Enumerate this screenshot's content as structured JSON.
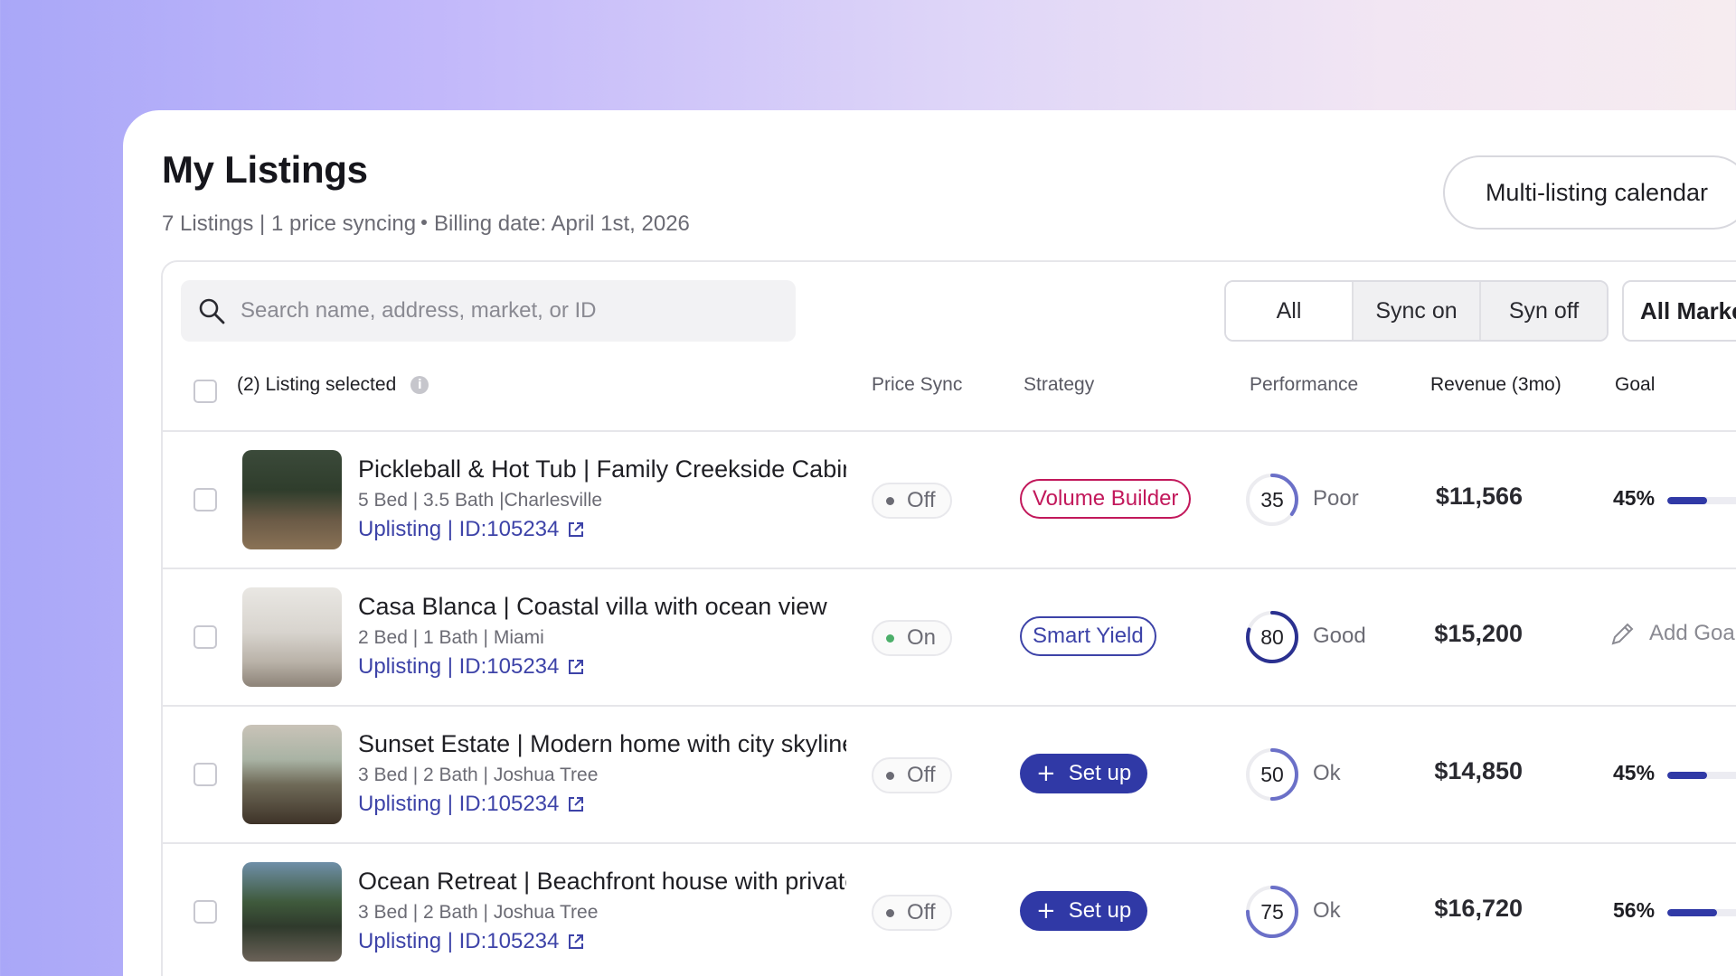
{
  "header": {
    "title": "My Listings",
    "summary": "7 Listings | 1 price syncing",
    "billing": "Billing date: April 1st, 2026",
    "calendar_button": "Multi-listing calendar"
  },
  "toolbar": {
    "search_placeholder": "Search name, address, market, or ID",
    "filters": [
      "All",
      "Sync on",
      "Syn off"
    ],
    "market_filter": "All Markets"
  },
  "table": {
    "selection_label": "(2) Listing selected",
    "columns": {
      "price_sync": "Price Sync",
      "strategy": "Strategy",
      "performance": "Performance",
      "revenue": "Revenue (3mo)",
      "goal": "Goal"
    },
    "rows": [
      {
        "name": "Pickleball & Hot Tub | Family Creekside Cabin",
        "meta": "5 Bed | 3.5 Bath |Charlesville",
        "link": "Uplisting | ID:105234",
        "sync": "Off",
        "strategy": "Volume Builder",
        "strategy_type": "outline",
        "strategy_color": "#c2185b",
        "score": "35",
        "score_value": 35,
        "rating": "Poor",
        "revenue": "$11,566",
        "goal": "45%",
        "goal_value": 0.45
      },
      {
        "name": "Casa Blanca | Coastal villa with ocean view",
        "meta": "2 Bed | 1 Bath | Miami",
        "link": "Uplisting | ID:105234",
        "sync": "On",
        "strategy": "Smart Yield",
        "strategy_type": "outline",
        "strategy_color": "#3d43a8",
        "score": "80",
        "score_value": 80,
        "rating": "Good",
        "revenue": "$15,200",
        "goal": "Add Goal",
        "goal_value": null
      },
      {
        "name": "Sunset Estate | Modern home with city skyline",
        "meta": "3 Bed | 2 Bath | Joshua Tree",
        "link": "Uplisting | ID:105234",
        "sync": "Off",
        "strategy": "Set up",
        "strategy_type": "button",
        "strategy_color": "#3039a6",
        "score": "50",
        "score_value": 50,
        "rating": "Ok",
        "revenue": "$14,850",
        "goal": "45%",
        "goal_value": 0.45
      },
      {
        "name": "Ocean Retreat | Beachfront house with private pool",
        "meta": "3 Bed | 2 Bath | Joshua Tree",
        "link": "Uplisting | ID:105234",
        "sync": "Off",
        "strategy": "Set up",
        "strategy_type": "button",
        "strategy_color": "#3039a6",
        "score": "75",
        "score_value": 75,
        "rating": "Ok",
        "revenue": "$16,720",
        "goal": "56%",
        "goal_value": 0.56
      }
    ]
  },
  "colors": {
    "accent": "#3039a6",
    "link": "#3d43a8",
    "sync_on": "#4caf6a",
    "sync_off": "#6b6b74"
  }
}
